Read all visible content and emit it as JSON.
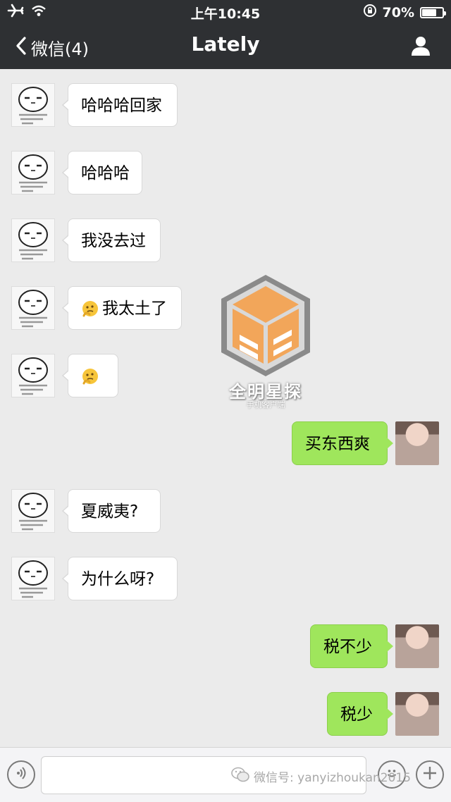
{
  "status": {
    "time": "上午10:45",
    "battery": "70%",
    "battery_level": 0.7
  },
  "nav": {
    "back_label": "微信(4)",
    "title": "Lately"
  },
  "messages": [
    {
      "side": "in",
      "text": "哈哈哈回家"
    },
    {
      "side": "in",
      "text": "哈哈哈"
    },
    {
      "side": "in",
      "text": "我没去过"
    },
    {
      "side": "in",
      "text": "我太土了",
      "emoji": "thinking-emoji"
    },
    {
      "side": "in",
      "text": "",
      "emoji": "thinking-emoji"
    },
    {
      "side": "out",
      "text": "买东西爽"
    },
    {
      "side": "in",
      "text": "夏威夷?"
    },
    {
      "side": "in",
      "text": "为什么呀?"
    },
    {
      "side": "out",
      "text": "税不少"
    },
    {
      "side": "out",
      "text": "税少"
    }
  ],
  "watermark": {
    "name": "全明星探",
    "sub": "手机客户端"
  },
  "footer": {
    "wechat_id": "微信号: yanyizhoukan2015"
  },
  "colors": {
    "topbar": "#2e3033",
    "background": "#ebebeb",
    "outgoing_bubble": "#9fe65c",
    "incoming_bubble": "#ffffff"
  },
  "icons": {
    "airplane": "airplane-icon",
    "wifi": "wifi-icon",
    "lock": "rotation-lock-icon",
    "back": "chevron-left-icon",
    "profile": "person-icon",
    "voice": "voice-icon",
    "emoji": "smiley-icon",
    "plus": "plus-icon"
  }
}
